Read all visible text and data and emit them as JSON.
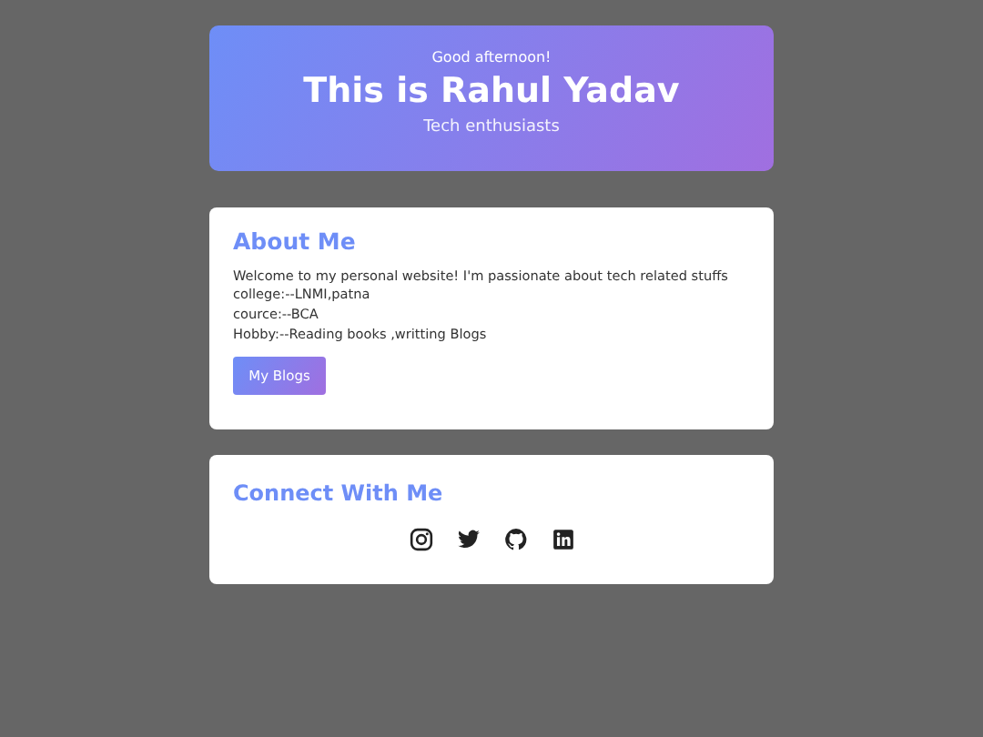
{
  "header": {
    "greeting": "Good afternoon!",
    "title": "This is Rahul Yadav",
    "subtitle": "Tech enthusiasts"
  },
  "about": {
    "heading": "About Me",
    "lines": [
      "Welcome to my personal website! I'm passionate about tech related stuffs",
      "college:--LNMI,patna",
      "cource:--BCA",
      "Hobby:--Reading books ,writting Blogs"
    ],
    "button": "My Blogs"
  },
  "connect": {
    "heading": "Connect With Me"
  }
}
